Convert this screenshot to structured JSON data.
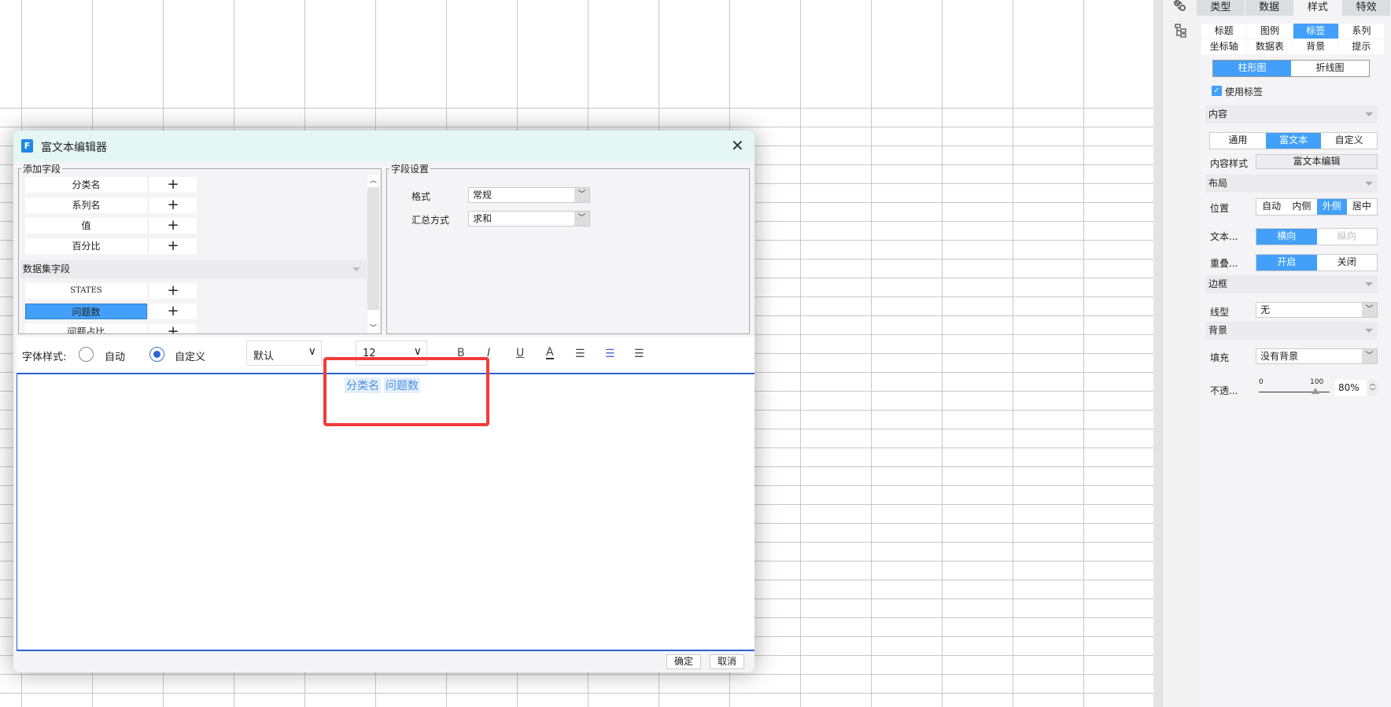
{
  "panel": {
    "tabs": [
      "类型",
      "数据",
      "样式",
      "特效"
    ],
    "active_tab": 2,
    "subtabs": [
      "标题",
      "图例",
      "标签",
      "系列",
      "坐标轴",
      "数据表",
      "背景",
      "提示"
    ],
    "active_subtab": 2,
    "chart_types": [
      "柱形图",
      "折线图"
    ],
    "use_label": "使用标签",
    "content_section": "内容",
    "content_modes": [
      "通用",
      "富文本",
      "自定义"
    ],
    "content_style_label": "内容样式",
    "content_style_button": "富文本编辑",
    "layout_section": "布局",
    "position_label": "位置",
    "positions": [
      "自动",
      "内侧",
      "外侧",
      "居中"
    ],
    "text_label": "文本...",
    "text_dirs": [
      "横向",
      "纵向"
    ],
    "overlap_label": "重叠...",
    "overlap": [
      "开启",
      "关闭"
    ],
    "border_section": "边框",
    "line_label": "线型",
    "line_value": "无",
    "bg_section": "背景",
    "fill_label": "填充",
    "fill_value": "没有背景",
    "opacity_label": "不透...",
    "opacity_min": "0",
    "opacity_max": "100",
    "opacity_value": "80%",
    "opacity_percent": 80
  },
  "dialog": {
    "title": "富文本编辑器",
    "add_fields_legend": "添加字段",
    "fields": [
      "分类名",
      "系列名",
      "值",
      "百分比"
    ],
    "dataset_section": "数据集字段",
    "dataset_fields": [
      "STATES",
      "问题数",
      "问题占比"
    ],
    "plus": "+",
    "field_settings_legend": "字段设置",
    "format_label": "格式",
    "format_value": "常规",
    "agg_label": "汇总方式",
    "agg_value": "求和",
    "font_style_label": "字体样式:",
    "auto": "自动",
    "custom": "自定义",
    "font_value": "默认",
    "size_value": "12",
    "fmt": {
      "bold": "B",
      "italic": "I",
      "underline": "U",
      "color": "A"
    },
    "tokens": [
      "分类名",
      "问题数"
    ],
    "ok": "确定",
    "cancel": "取消"
  }
}
